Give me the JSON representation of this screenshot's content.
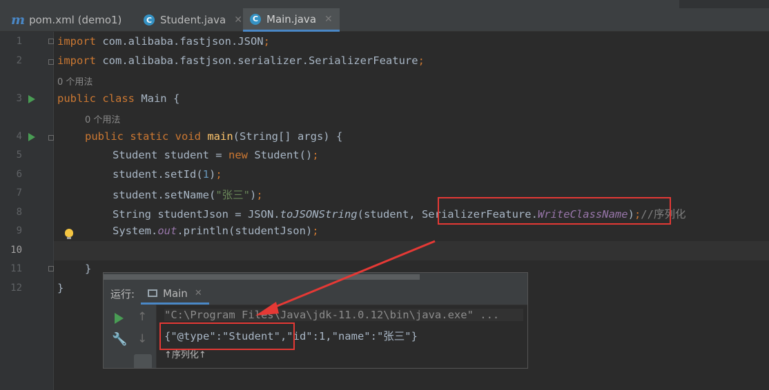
{
  "tabs": [
    {
      "label": "pom.xml (demo1)",
      "icon": "maven-icon"
    },
    {
      "label": "Student.java",
      "icon": "java-class-icon"
    },
    {
      "label": "Main.java",
      "icon": "java-class-icon",
      "active": true
    }
  ],
  "gutter": {
    "line_numbers": [
      "1",
      "2",
      "3",
      "4",
      "5",
      "6",
      "7",
      "8",
      "9",
      "10",
      "11",
      "12"
    ],
    "current_line": "10"
  },
  "code": {
    "hint_usages": "0 个用法",
    "l1_kw": "import",
    "l1_rest": " com.alibaba.fastjson.JSON",
    "semicolon": ";",
    "l2_kw": "import",
    "l2_rest": " com.alibaba.fastjson.serializer.SerializerFeature",
    "l3_kw": "public class",
    "l3_rest": " Main {",
    "l4_kw": "public static void",
    "l4_fn": "main",
    "l4_rest": "(String[] args) {",
    "l5_a": "Student student = ",
    "l5_kw": "new",
    "l5_b": " Student()",
    "l6_a": "student.setId(",
    "l6_num": "1",
    "l6_b": ")",
    "l7_a": "student.setName(",
    "l7_str": "\"张三\"",
    "l7_b": ")",
    "l8_a": "String studentJson = JSON.",
    "l8_m": "toJSONString",
    "l8_b": "(student, ",
    "l8_c": "SerializerFeature.",
    "l8_f": "WriteClassName",
    "l8_d": ")",
    "l8_cmt": "//序列化",
    "l9_a": "System.",
    "l9_f": "out",
    "l9_b": ".println(studentJson)",
    "l11": "}",
    "l12": "}"
  },
  "run_panel": {
    "label": "运行:",
    "tab_label": "Main",
    "command": "\"C:\\Program Files\\Java\\jdk-11.0.12\\bin\\java.exe\" ...",
    "output": "{\"@type\":\"Student\",\"id\":1,\"name\":\"张三\"}",
    "caption": "↑序列化↑"
  },
  "colors": {
    "annotation": "#e53935",
    "keyword": "#cc7832",
    "string": "#6a8759",
    "number": "#6897bb"
  }
}
